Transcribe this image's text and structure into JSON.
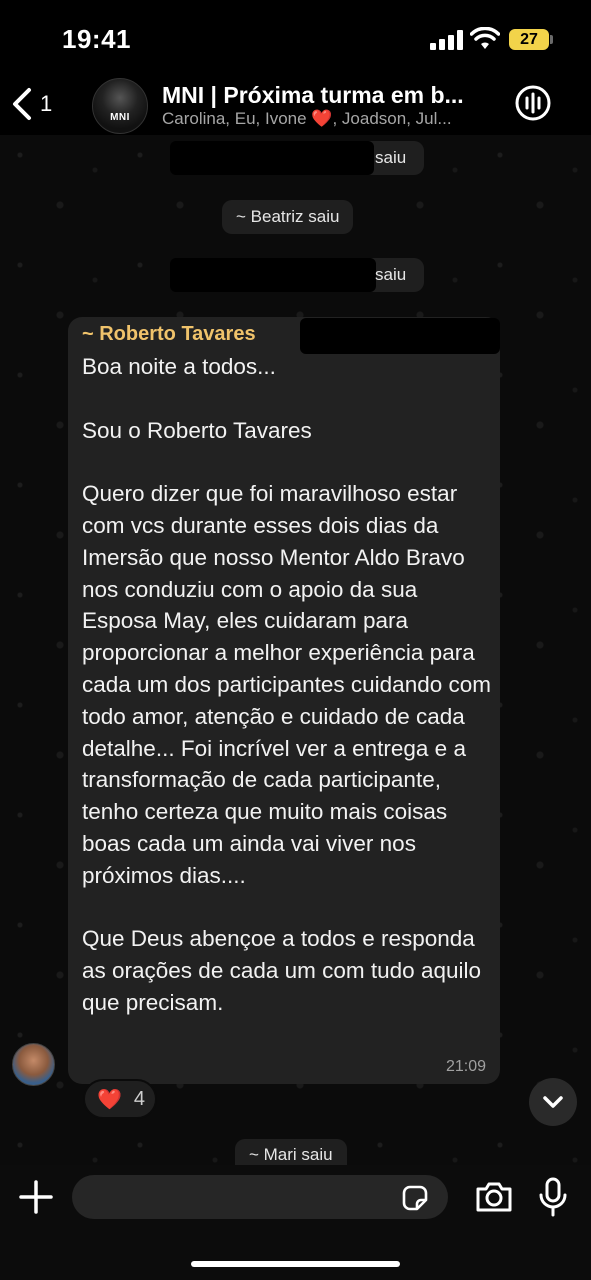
{
  "status_bar": {
    "time": "19:41",
    "battery": "27"
  },
  "header": {
    "back_count": "1",
    "avatar_text": "MNI",
    "title": "MNI | Próxima turma em b...",
    "subtitle": "Carolina, Eu, Ivone ❤️, Joadson, Jul..."
  },
  "system_messages": [
    {
      "text": "saiu"
    },
    {
      "text": "~ Beatriz saiu"
    },
    {
      "text": "saiu"
    },
    {
      "text": "~ Mari saiu"
    }
  ],
  "message": {
    "sender": "~ Roberto Tavares",
    "text": "Boa noite a todos...\n\nSou o Roberto Tavares\n\nQuero dizer que foi maravilhoso estar com vcs durante esses dois dias da Imersão que nosso Mentor Aldo Bravo nos conduziu com o apoio da sua Esposa May, eles cuidaram para proporcionar a melhor experiência para cada um dos participantes cuidando com todo amor, atenção e cuidado de cada detalhe... Foi incrível ver a entrega e a transformação de cada participante, tenho certeza que muito mais coisas boas cada um ainda vai viver nos próximos dias....\n\nQue Deus abençoe a todos e responda as orações de cada um com tudo aquilo que precisam.",
    "time": "21:09",
    "reaction": {
      "emoji": "❤️",
      "count": "4"
    }
  },
  "input": {
    "placeholder": ""
  },
  "icons": {
    "back": "chevron-left-icon",
    "call": "audio-call-icon",
    "plus": "plus-icon",
    "sticker": "sticker-icon",
    "camera": "camera-icon",
    "mic": "microphone-icon",
    "scroll": "chevron-down-icon"
  },
  "colors": {
    "sender_name": "#f0c36b",
    "bubble": "#222222",
    "battery": "#f2d34a"
  }
}
